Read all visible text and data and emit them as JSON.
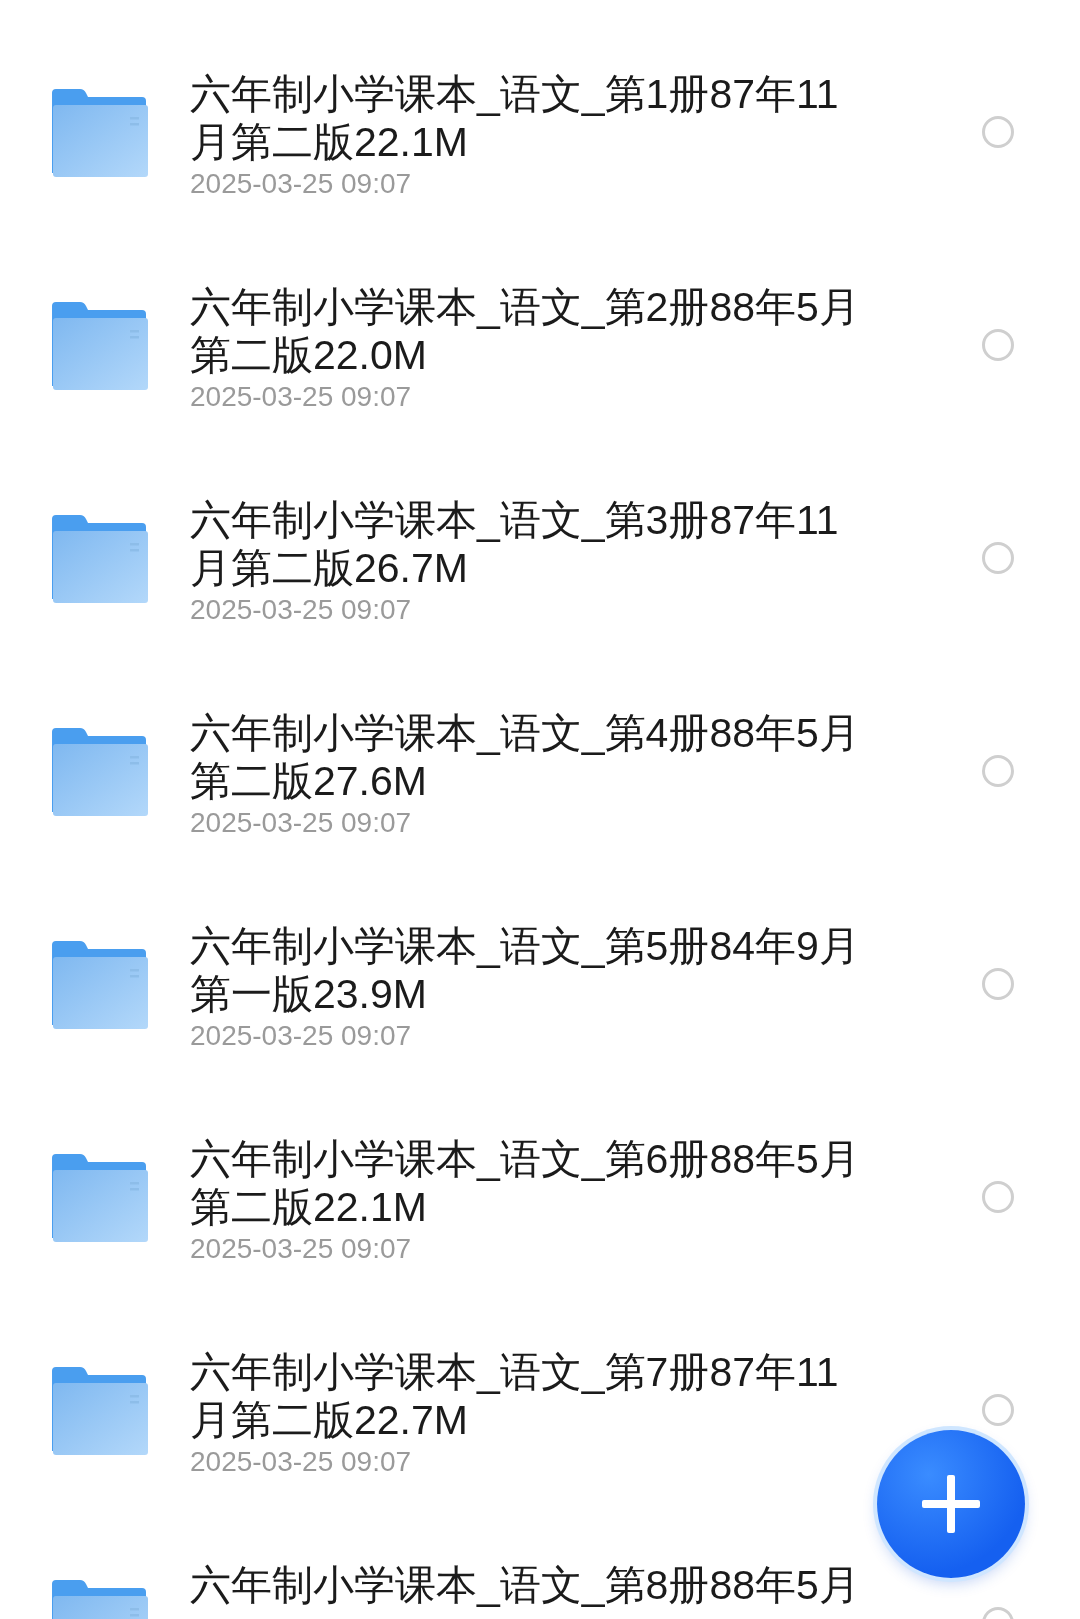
{
  "files": [
    {
      "title": "六年制小学课本_语文_第1册87年11月第二版22.1M",
      "date": "2025-03-25 09:07",
      "selected": false
    },
    {
      "title": "六年制小学课本_语文_第2册88年5月第二版22.0M",
      "date": "2025-03-25 09:07",
      "selected": false
    },
    {
      "title": "六年制小学课本_语文_第3册87年11月第二版26.7M",
      "date": "2025-03-25 09:07",
      "selected": false
    },
    {
      "title": "六年制小学课本_语文_第4册88年5月第二版27.6M",
      "date": "2025-03-25 09:07",
      "selected": false
    },
    {
      "title": "六年制小学课本_语文_第5册84年9月第一版23.9M",
      "date": "2025-03-25 09:07",
      "selected": false
    },
    {
      "title": "六年制小学课本_语文_第6册88年5月第二版22.1M",
      "date": "2025-03-25 09:07",
      "selected": false
    },
    {
      "title": "六年制小学课本_语文_第7册87年11月第二版22.7M",
      "date": "2025-03-25 09:07",
      "selected": false
    },
    {
      "title": "六年制小学课本_语文_第8册88年5月",
      "selected": false
    }
  ]
}
